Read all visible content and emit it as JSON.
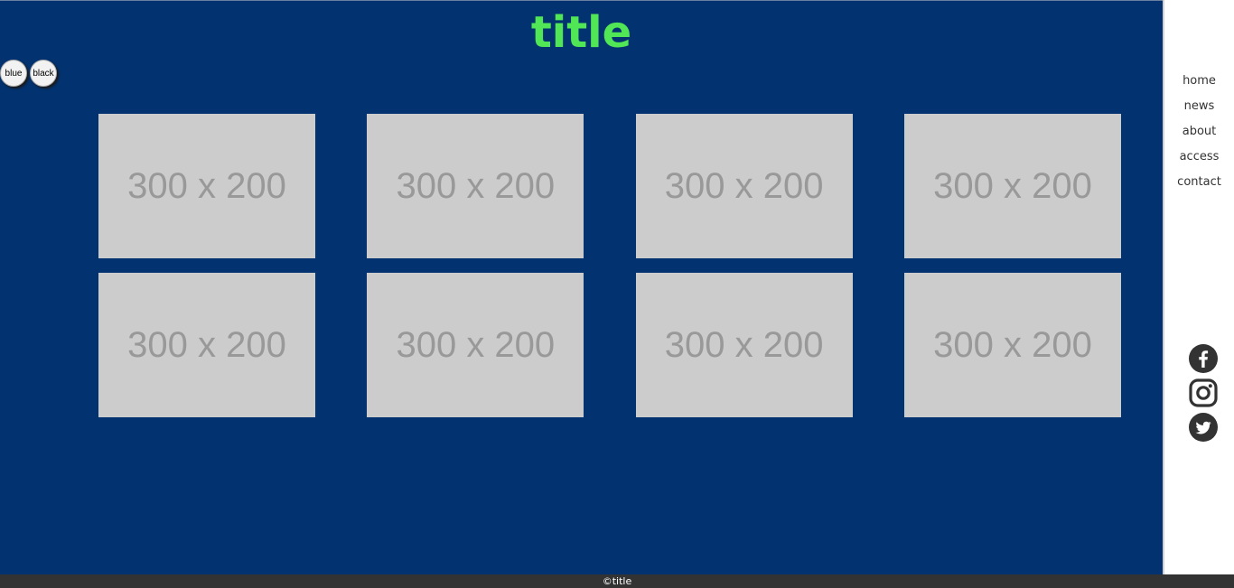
{
  "header": {
    "title": "title",
    "title_color": "#50e655"
  },
  "theme_buttons": [
    {
      "label": "blue"
    },
    {
      "label": "black"
    }
  ],
  "gallery": {
    "items": [
      {
        "label": "300 x 200"
      },
      {
        "label": "300 x 200"
      },
      {
        "label": "300 x 200"
      },
      {
        "label": "300 x 200"
      },
      {
        "label": "300 x 200"
      },
      {
        "label": "300 x 200"
      },
      {
        "label": "300 x 200"
      },
      {
        "label": "300 x 200"
      }
    ]
  },
  "nav": {
    "items": [
      {
        "label": "home"
      },
      {
        "label": "news"
      },
      {
        "label": "about"
      },
      {
        "label": "access"
      },
      {
        "label": "contact"
      }
    ]
  },
  "social": {
    "icons": [
      "facebook-icon",
      "instagram-icon",
      "twitter-icon"
    ]
  },
  "footer": {
    "copyright": "©title"
  },
  "colors": {
    "main_bg": "#02326f",
    "placeholder_bg": "#cccccc",
    "placeholder_text": "#999999",
    "footer_bg": "#333333"
  }
}
